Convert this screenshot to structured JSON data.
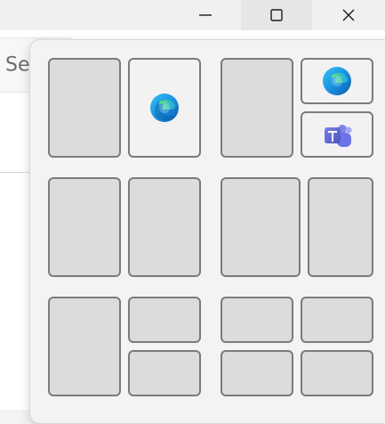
{
  "window": {
    "controls": {
      "minimize_icon": "minimize-icon",
      "maximize_icon": "maximize-icon",
      "close_icon": "close-icon"
    },
    "search_text": "Sea"
  },
  "snap_layouts": {
    "groups": [
      {
        "name": "layout-1",
        "zones": [
          {
            "app": null
          },
          {
            "app": "edge-icon"
          }
        ]
      },
      {
        "name": "layout-2",
        "zones": [
          {
            "app": null
          },
          {
            "app": "edge-icon"
          },
          {
            "app": "teams-icon"
          }
        ]
      },
      {
        "name": "layout-3",
        "zones": [
          {
            "app": null
          },
          {
            "app": null
          }
        ]
      },
      {
        "name": "layout-4",
        "zones": [
          {
            "app": null
          },
          {
            "app": null
          }
        ]
      },
      {
        "name": "layout-5",
        "zones": [
          {
            "app": null
          },
          {
            "app": null
          },
          {
            "app": null
          }
        ]
      },
      {
        "name": "layout-6",
        "zones": [
          {
            "app": null
          },
          {
            "app": null
          },
          {
            "app": null
          },
          {
            "app": null
          }
        ]
      }
    ]
  }
}
